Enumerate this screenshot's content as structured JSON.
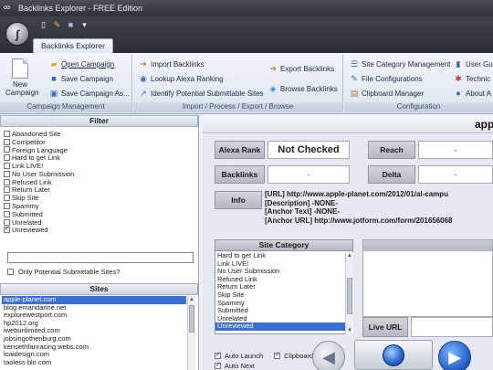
{
  "window": {
    "title": "Backlinks Explorer - FREE Edition"
  },
  "ribbon": {
    "tab": "Backlinks Explorer",
    "campaign": {
      "label": "Campaign Management",
      "new_campaign_line1": "New",
      "new_campaign_line2": "Campaign",
      "open": "Open Campaign",
      "save": "Save Campaign",
      "save_as": "Save Campaign As..."
    },
    "import": {
      "label": "Import / Process / Export / Browse",
      "import_backlinks": "Import Backlinks",
      "lookup_alexa": "Lookup Alexa Ranking",
      "identify": "Identify Potential Submittable Sites",
      "export": "Export Backlinks",
      "browse": "Browse Backlinks"
    },
    "config": {
      "label": "Configuration",
      "site_category": "Site Category Management",
      "file_config": "File Configurations",
      "clipboard": "Clipboard Manager",
      "user_guide": "User Gui",
      "technical": "Technic",
      "about": "About A"
    }
  },
  "filter": {
    "title": "Filter",
    "items": [
      {
        "label": "Abandoned Site",
        "checked": false
      },
      {
        "label": "Competitor",
        "checked": false
      },
      {
        "label": "Foreign Language",
        "checked": false
      },
      {
        "label": "Hard to get Link",
        "checked": false
      },
      {
        "label": "Link LIVE!",
        "checked": false
      },
      {
        "label": "No User Submission",
        "checked": false
      },
      {
        "label": "Refused Link",
        "checked": false
      },
      {
        "label": "Return Later",
        "checked": false
      },
      {
        "label": "Skip Site",
        "checked": false
      },
      {
        "label": "Spammy",
        "checked": false
      },
      {
        "label": "Submitted",
        "checked": false
      },
      {
        "label": "Unrelated",
        "checked": false
      },
      {
        "label": "Unreviewed",
        "checked": true
      }
    ],
    "potential_label": "Only Potential Submittable Sites?"
  },
  "sites": {
    "title": "Sites",
    "items": [
      "apple-planet.com",
      "blog.emandarine.net",
      "explorewestport.com",
      "hp2012.org",
      "iwebunlimited.com",
      "jobsingothenburg.com",
      "kensethfanracing.webs.com",
      "loaidesign.com",
      "taoless blo com"
    ],
    "selected": 0
  },
  "detail": {
    "site_title": "app",
    "alexa_rank_label": "Alexa Rank",
    "alexa_rank_value": "Not Checked",
    "reach_label": "Reach",
    "reach_value": "-",
    "backlinks_label": "Backlinks",
    "backlinks_value": "-",
    "delta_label": "Delta",
    "delta_value": "-",
    "info_label": "Info",
    "info_lines": [
      "[URL] http://www.apple-planet.com/2012/01/al-campu",
      "[Description] -NONE-",
      "[Anchor Text] -NONE-",
      "[Anchor URL] http://www.jotform.com/form/201656068"
    ],
    "site_category_title": "Site Category",
    "categories": [
      "Hard to get Link",
      "Link LIVE!",
      "No User Submission",
      "Refused Link",
      "Return Later",
      "Skip Site",
      "Spammy",
      "Submitted",
      "Unrelated",
      "Unreviewed"
    ],
    "selected_category": 9,
    "live_url_label": "Live URL",
    "auto_launch": "Auto Launch",
    "clipboard": "Clipboard",
    "auto_next": "Auto Next"
  }
}
